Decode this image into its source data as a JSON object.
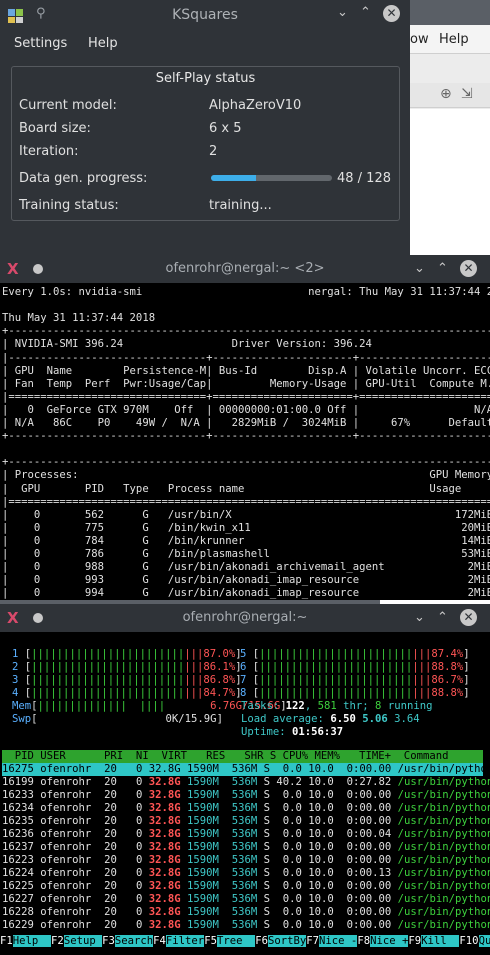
{
  "ksquares": {
    "title": "KSquares",
    "menu": [
      "Settings",
      "Help"
    ],
    "group_title": "Self-Play status",
    "rows": [
      {
        "label": "Current model:",
        "value": "AlphaZeroV10"
      },
      {
        "label": "Board size:",
        "value": "6 x 5"
      },
      {
        "label": "Iteration:",
        "value": "2"
      },
      {
        "label": "Data gen. progress:",
        "value": "48 / 128"
      },
      {
        "label": "Training status:",
        "value": "training..."
      }
    ],
    "progress_fraction": 0.375
  },
  "bg_window": {
    "menu": [
      "ow",
      "Help"
    ]
  },
  "term1": {
    "title": "ofenrohr@nergal:~ <2>",
    "lines": [
      "Every 1.0s: nvidia-smi                          nergal: Thu May 31 11:37:44 2018",
      "",
      "Thu May 31 11:37:44 2018",
      "+-----------------------------------------------------------------------------+",
      "| NVIDIA-SMI 396.24                 Driver Version: 396.24                    |",
      "|-------------------------------+----------------------+----------------------+",
      "| GPU  Name        Persistence-M| Bus-Id        Disp.A | Volatile Uncorr. ECC |",
      "| Fan  Temp  Perf  Pwr:Usage/Cap|         Memory-Usage | GPU-Util  Compute M. |",
      "|===============================+======================+======================|",
      "|   0  GeForce GTX 970M    Off  | 00000000:01:00.0 Off |                  N/A |",
      "| N/A   86C    P0    49W /  N/A |   2829MiB /  3024MiB |     67%      Default |",
      "+-------------------------------+----------------------+----------------------+",
      "",
      "+-----------------------------------------------------------------------------+",
      "| Processes:                                                       GPU Memory |",
      "|  GPU       PID   Type   Process name                             Usage      |",
      "|=============================================================================|",
      "|    0       562      G   /usr/bin/X                                   172MiB |",
      "|    0       775      G   /bin/kwin_x11                                 20MiB |",
      "|    0       784      G   /bin/krunner                                  14MiB |",
      "|    0       786      G   /bin/plasmashell                              53MiB |",
      "|    0       988      G   /usr/bin/akonadi_archivemail_agent             2MiB |",
      "|    0       993      G   /usr/bin/akonadi_imap_resource                 2MiB |",
      "|    0       994      G   /usr/bin/akonadi_imap_resource                 2MiB |"
    ]
  },
  "term2": {
    "title": "ofenrohr@nergal:~",
    "cpus": [
      {
        "n": "1",
        "bar": "||||||||||||||||||||||||",
        "pct": "87.0%"
      },
      {
        "n": "2",
        "bar": "||||||||||||||||||||||||",
        "pct": "86.1%"
      },
      {
        "n": "3",
        "bar": "||||||||||||||||||||||||",
        "pct": "86.8%"
      },
      {
        "n": "4",
        "bar": "||||||||||||||||||||||||",
        "pct": "84.7%"
      },
      {
        "n": "5",
        "bar": "||||||||||||||||||||||||",
        "pct": "87.4%"
      },
      {
        "n": "6",
        "bar": "||||||||||||||||||||||||",
        "pct": "88.8%"
      },
      {
        "n": "7",
        "bar": "||||||||||||||||||||||||",
        "pct": "86.7%"
      },
      {
        "n": "8",
        "bar": "||||||||||||||||||||||||",
        "pct": "88.8%"
      }
    ],
    "mem": {
      "label": "Mem",
      "bar": "||||||||||||||  ||||",
      "value": "6.76G/15.6G"
    },
    "swp": {
      "label": "Swp",
      "bar": "",
      "value": "0K/15.9G"
    },
    "tasks_label": "Tasks:",
    "tasks": "122",
    "thr_count": "581",
    "thr_label": "thr;",
    "running": "8",
    "running_label": "running",
    "load_label": "Load average:",
    "load1": "6.50",
    "load5": "5.06",
    "load15": "3.64",
    "uptime_label": "Uptime:",
    "uptime": "01:56:37",
    "header": "  PID USER      PRI  NI  VIRT   RES   SHR S CPU% MEM%   TIME+  Command",
    "processes": [
      {
        "pid": "16275",
        "user": "ofenrohr",
        "pri": "20",
        "ni": "0",
        "virt": "32.8G",
        "res": "1590M",
        "shr": "536M",
        "s": "S",
        "cpu": "0.0",
        "mem": "10.0",
        "time": "0:00.00",
        "cmd": "/usr/bin/python2."
      },
      {
        "pid": "16199",
        "user": "ofenrohr",
        "pri": "20",
        "ni": "0",
        "virt": "32.8G",
        "res": "1590M",
        "shr": "536M",
        "s": "S",
        "cpu": "40.2",
        "mem": "10.0",
        "time": "0:27.82",
        "cmd": "/usr/bin/python2."
      },
      {
        "pid": "16233",
        "user": "ofenrohr",
        "pri": "20",
        "ni": "0",
        "virt": "32.8G",
        "res": "1590M",
        "shr": "536M",
        "s": "S",
        "cpu": "0.0",
        "mem": "10.0",
        "time": "0:00.00",
        "cmd": "/usr/bin/python2."
      },
      {
        "pid": "16234",
        "user": "ofenrohr",
        "pri": "20",
        "ni": "0",
        "virt": "32.8G",
        "res": "1590M",
        "shr": "536M",
        "s": "S",
        "cpu": "0.0",
        "mem": "10.0",
        "time": "0:00.00",
        "cmd": "/usr/bin/python2."
      },
      {
        "pid": "16235",
        "user": "ofenrohr",
        "pri": "20",
        "ni": "0",
        "virt": "32.8G",
        "res": "1590M",
        "shr": "536M",
        "s": "S",
        "cpu": "0.0",
        "mem": "10.0",
        "time": "0:00.00",
        "cmd": "/usr/bin/python2."
      },
      {
        "pid": "16236",
        "user": "ofenrohr",
        "pri": "20",
        "ni": "0",
        "virt": "32.8G",
        "res": "1590M",
        "shr": "536M",
        "s": "S",
        "cpu": "0.0",
        "mem": "10.0",
        "time": "0:00.04",
        "cmd": "/usr/bin/python2."
      },
      {
        "pid": "16237",
        "user": "ofenrohr",
        "pri": "20",
        "ni": "0",
        "virt": "32.8G",
        "res": "1590M",
        "shr": "536M",
        "s": "S",
        "cpu": "0.0",
        "mem": "10.0",
        "time": "0:00.00",
        "cmd": "/usr/bin/python2."
      },
      {
        "pid": "16223",
        "user": "ofenrohr",
        "pri": "20",
        "ni": "0",
        "virt": "32.8G",
        "res": "1590M",
        "shr": "536M",
        "s": "S",
        "cpu": "0.0",
        "mem": "10.0",
        "time": "0:00.00",
        "cmd": "/usr/bin/python2."
      },
      {
        "pid": "16224",
        "user": "ofenrohr",
        "pri": "20",
        "ni": "0",
        "virt": "32.8G",
        "res": "1590M",
        "shr": "536M",
        "s": "S",
        "cpu": "0.0",
        "mem": "10.0",
        "time": "0:00.13",
        "cmd": "/usr/bin/python2."
      },
      {
        "pid": "16225",
        "user": "ofenrohr",
        "pri": "20",
        "ni": "0",
        "virt": "32.8G",
        "res": "1590M",
        "shr": "536M",
        "s": "S",
        "cpu": "0.0",
        "mem": "10.0",
        "time": "0:00.00",
        "cmd": "/usr/bin/python2."
      },
      {
        "pid": "16227",
        "user": "ofenrohr",
        "pri": "20",
        "ni": "0",
        "virt": "32.8G",
        "res": "1590M",
        "shr": "536M",
        "s": "S",
        "cpu": "0.0",
        "mem": "10.0",
        "time": "0:00.00",
        "cmd": "/usr/bin/python2."
      },
      {
        "pid": "16228",
        "user": "ofenrohr",
        "pri": "20",
        "ni": "0",
        "virt": "32.8G",
        "res": "1590M",
        "shr": "536M",
        "s": "S",
        "cpu": "0.0",
        "mem": "10.0",
        "time": "0:00.00",
        "cmd": "/usr/bin/python2."
      },
      {
        "pid": "16229",
        "user": "ofenrohr",
        "pri": "20",
        "ni": "0",
        "virt": "32.8G",
        "res": "1590M",
        "shr": "536M",
        "s": "S",
        "cpu": "0.0",
        "mem": "10.0",
        "time": "0:00.00",
        "cmd": "/usr/bin/python2."
      }
    ],
    "fkeys": [
      {
        "key": "F1",
        "label": "Help  "
      },
      {
        "key": "F2",
        "label": "Setup "
      },
      {
        "key": "F3",
        "label": "Search"
      },
      {
        "key": "F4",
        "label": "Filter"
      },
      {
        "key": "F5",
        "label": "Tree  "
      },
      {
        "key": "F6",
        "label": "SortBy"
      },
      {
        "key": "F7",
        "label": "Nice -"
      },
      {
        "key": "F8",
        "label": "Nice +"
      },
      {
        "key": "F9",
        "label": "Kill  "
      },
      {
        "key": "F10",
        "label": "Quit"
      }
    ]
  },
  "colors": {
    "accent": "#3daee9",
    "htop_header": "#2ea32e",
    "htop_selected": "#2ec6c6"
  }
}
